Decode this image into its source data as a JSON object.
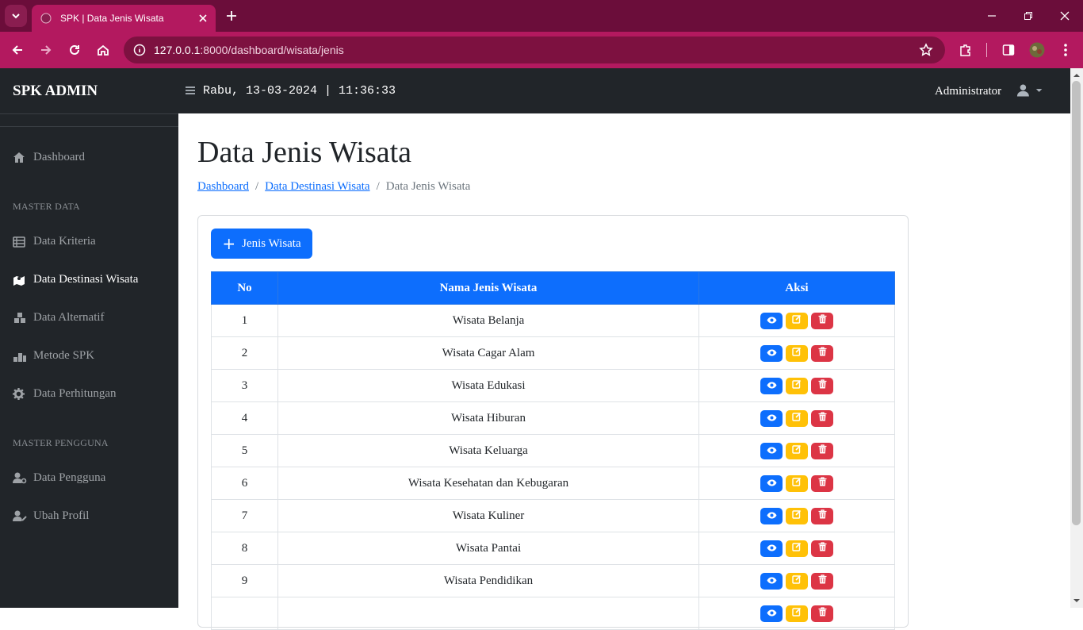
{
  "browser": {
    "tab_title": "SPK | Data Jenis Wisata",
    "url_host": "127.0.0.1",
    "url_rest": ":8000/dashboard/wisata/jenis"
  },
  "navbar": {
    "brand": "SPK ADMIN",
    "clock": "Rabu, 13-03-2024 | 11:36:33",
    "user": "Administrator"
  },
  "sidebar": {
    "dashboard": "Dashboard",
    "heading_master": "MASTER DATA",
    "items": [
      "Data Kriteria",
      "Data Destinasi Wisata",
      "Data Alternatif",
      "Metode SPK",
      "Data Perhitungan"
    ],
    "heading_users": "MASTER PENGGUNA",
    "user_items": [
      "Data Pengguna",
      "Ubah Profil"
    ]
  },
  "page": {
    "title": "Data Jenis Wisata",
    "breadcrumb": [
      "Dashboard",
      "Data Destinasi Wisata",
      "Data Jenis Wisata"
    ],
    "add_button": "Jenis Wisata"
  },
  "table": {
    "headers": [
      "No",
      "Nama Jenis Wisata",
      "Aksi"
    ],
    "rows": [
      {
        "no": "1",
        "name": "Wisata Belanja"
      },
      {
        "no": "2",
        "name": "Wisata Cagar Alam"
      },
      {
        "no": "3",
        "name": "Wisata Edukasi"
      },
      {
        "no": "4",
        "name": "Wisata Hiburan"
      },
      {
        "no": "5",
        "name": "Wisata Keluarga"
      },
      {
        "no": "6",
        "name": "Wisata Kesehatan dan Kebugaran"
      },
      {
        "no": "7",
        "name": "Wisata Kuliner"
      },
      {
        "no": "8",
        "name": "Wisata Pantai"
      },
      {
        "no": "9",
        "name": "Wisata Pendidikan"
      },
      {
        "no": "",
        "name": ""
      }
    ]
  },
  "colors": {
    "primary": "#0d6efd",
    "warning": "#ffc107",
    "danger": "#dc3545",
    "dark": "#212529",
    "browser": "#b3195f"
  }
}
